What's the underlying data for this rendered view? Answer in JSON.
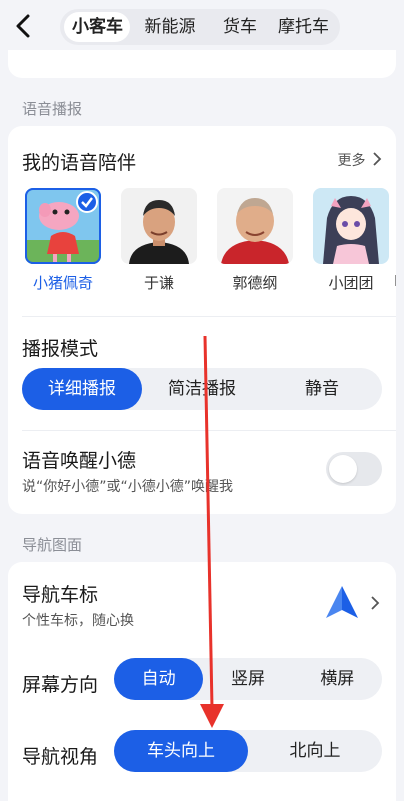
{
  "header": {
    "tabs": [
      "小客车",
      "新能源",
      "货车",
      "摩托车"
    ],
    "active_tab": 0
  },
  "voice_section": {
    "label": "语音播报",
    "companion_title": "我的语音陪伴",
    "more_label": "更多",
    "avatars": [
      {
        "name": "小猪佩奇",
        "selected": true
      },
      {
        "name": "于谦",
        "selected": false
      },
      {
        "name": "郭德纲",
        "selected": false
      },
      {
        "name": "小团团",
        "selected": false
      },
      {
        "name": "D",
        "selected": false
      }
    ],
    "mode_title": "播报模式",
    "mode_options": [
      "详细播报",
      "简洁播报",
      "静音"
    ],
    "mode_selected": 0,
    "wake_title": "语音唤醒小德",
    "wake_sub": "说“你好小德”或“小德小德”唤醒我",
    "wake_enabled": false
  },
  "nav_section": {
    "label": "导航图面",
    "car_icon_title": "导航车标",
    "car_icon_sub": "个性车标，随心换",
    "orientation_title": "屏幕方向",
    "orientation_options": [
      "自动",
      "竖屏",
      "横屏"
    ],
    "orientation_selected": 0,
    "view_title": "导航视角",
    "view_options": [
      "车头向上",
      "北向上"
    ],
    "view_selected": 0
  },
  "colors": {
    "accent": "#1c5fe6",
    "annotation_arrow": "#e8322b"
  }
}
